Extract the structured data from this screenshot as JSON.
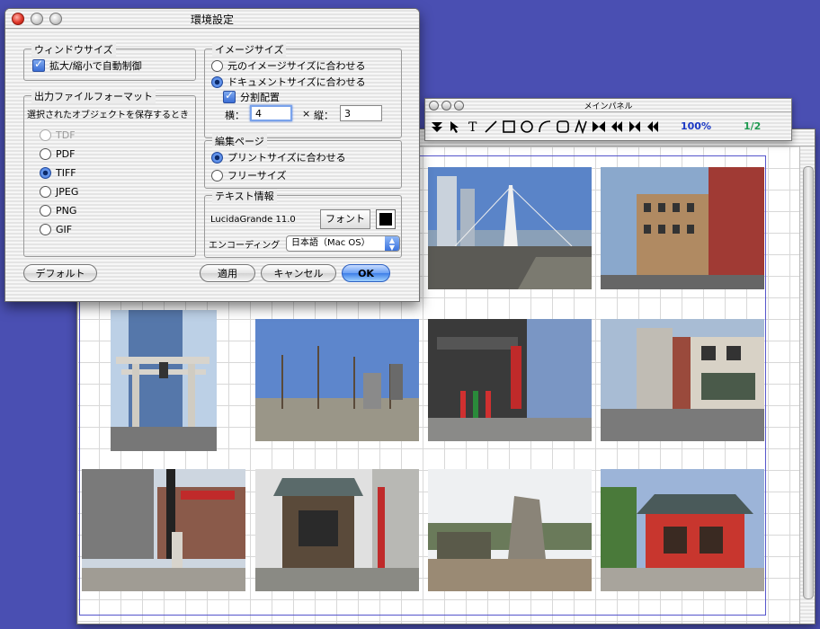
{
  "prefs": {
    "title": "環境設定",
    "window_size": {
      "label": "ウィンドウサイズ",
      "auto_resize_label": "拡大/縮小で自動制御",
      "auto_resize_checked": true
    },
    "output_format": {
      "label": "出力ファイルフォーマット",
      "description": "選択されたオブジェクトを保存するとき",
      "options": [
        "TDF",
        "PDF",
        "TIFF",
        "JPEG",
        "PNG",
        "GIF"
      ],
      "selected": "TIFF"
    },
    "image_size": {
      "label": "イメージサイズ",
      "option_original": "元のイメージサイズに合わせる",
      "option_document": "ドキュメントサイズに合わせる",
      "selected": "ドキュメントサイズに合わせる",
      "split_label": "分割配置",
      "split_checked": true,
      "horizontal_label": "横：",
      "horizontal_value": "4",
      "times": "×",
      "vertical_label": "縦：",
      "vertical_value": "3"
    },
    "edit_page": {
      "label": "編集ページ",
      "option_print": "プリントサイズに合わせる",
      "option_free": "フリーサイズ",
      "selected": "プリントサイズに合わせる"
    },
    "text_info": {
      "label": "テキスト情報",
      "font_name": "LucidaGrande 11.0",
      "font_button": "フォント",
      "text_color": "#000000",
      "encoding_label": "エンコーディング",
      "encoding_value": "日本語（Mac OS）"
    },
    "buttons": {
      "default": "デフォルト",
      "apply": "適用",
      "cancel": "キャンセル",
      "ok": "OK"
    }
  },
  "palette": {
    "title": "メインパネル",
    "tools": [
      "move-down-icon",
      "arrow-pointer-icon",
      "text-tool-icon",
      "line-tool-icon",
      "rectangle-tool-icon",
      "ellipse-tool-icon",
      "arc-tool-icon",
      "rounded-rect-tool-icon",
      "freehand-tool-icon",
      "first-page-icon",
      "previous-page-icon",
      "next-page-icon",
      "last-page-icon"
    ],
    "zoom": "100%",
    "page": "1/2"
  },
  "document": {
    "photos": [
      "riverside-bridge-photo",
      "old-building-photo",
      "torii-gate-photo",
      "park-trees-photo",
      "shrine-banners-photo",
      "corner-building-photo",
      "street-corner-photo",
      "small-shrine-photo",
      "stone-monument-photo",
      "red-shrine-photo"
    ]
  }
}
